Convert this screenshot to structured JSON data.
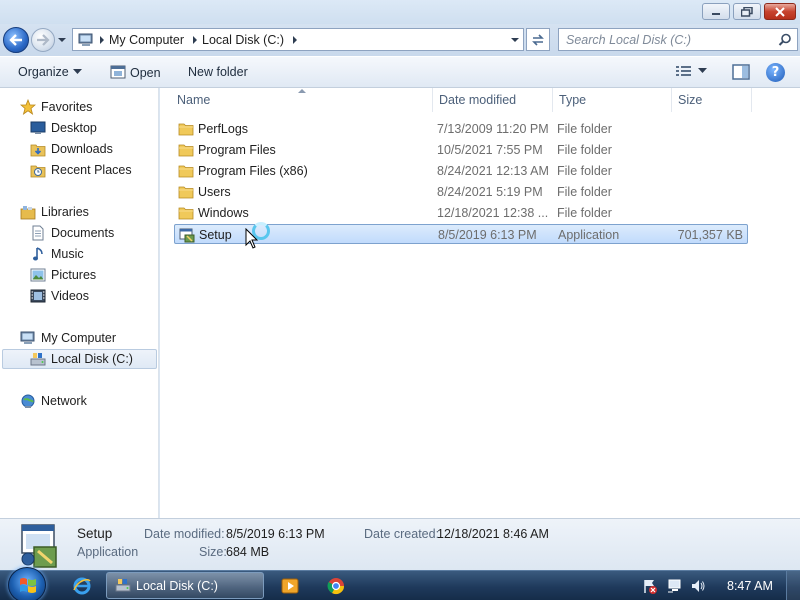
{
  "window": {
    "controls": {
      "minimize": "minimize-icon",
      "maximize": "restore-icon",
      "close": "close-icon"
    }
  },
  "address": {
    "breadcrumbs": [
      "My Computer",
      "Local Disk (C:)"
    ],
    "search_placeholder": "Search Local Disk (C:)"
  },
  "toolbar": {
    "organize": "Organize",
    "open": "Open",
    "new_folder": "New folder"
  },
  "nav": {
    "favorites": "Favorites",
    "desktop": "Desktop",
    "downloads": "Downloads",
    "recent_places": "Recent Places",
    "libraries": "Libraries",
    "documents": "Documents",
    "music": "Music",
    "pictures": "Pictures",
    "videos": "Videos",
    "my_computer": "My Computer",
    "local_disk": "Local Disk (C:)",
    "network": "Network"
  },
  "columns": {
    "name": "Name",
    "date_modified": "Date modified",
    "type": "Type",
    "size": "Size"
  },
  "files": [
    {
      "name": "PerfLogs",
      "date": "7/13/2009 11:20 PM",
      "type": "File folder",
      "size": "",
      "icon": "folder-icon"
    },
    {
      "name": "Program Files",
      "date": "10/5/2021 7:55 PM",
      "type": "File folder",
      "size": "",
      "icon": "folder-icon"
    },
    {
      "name": "Program Files (x86)",
      "date": "8/24/2021 12:13 AM",
      "type": "File folder",
      "size": "",
      "icon": "folder-icon"
    },
    {
      "name": "Users",
      "date": "8/24/2021 5:19 PM",
      "type": "File folder",
      "size": "",
      "icon": "folder-icon"
    },
    {
      "name": "Windows",
      "date": "12/18/2021 12:38 ...",
      "type": "File folder",
      "size": "",
      "icon": "folder-icon"
    },
    {
      "name": "Setup",
      "date": "8/5/2019 6:13 PM",
      "type": "Application",
      "size": "701,357 KB",
      "icon": "setup-app-icon",
      "selected": true
    }
  ],
  "details": {
    "name": "Setup",
    "type": "Application",
    "date_modified_label": "Date modified:",
    "date_modified": "8/5/2019 6:13 PM",
    "size_label": "Size:",
    "size": "684 MB",
    "date_created_label": "Date created:",
    "date_created": "12/18/2021 8:46 AM"
  },
  "taskbar": {
    "active_window": "Local Disk (C:)",
    "clock": "8:47 AM"
  },
  "colors": {
    "selection": "#cce4fc",
    "selection_border": "#7da2ce",
    "taskbar": "#1f3a5c",
    "folder": "#f0c95a"
  }
}
